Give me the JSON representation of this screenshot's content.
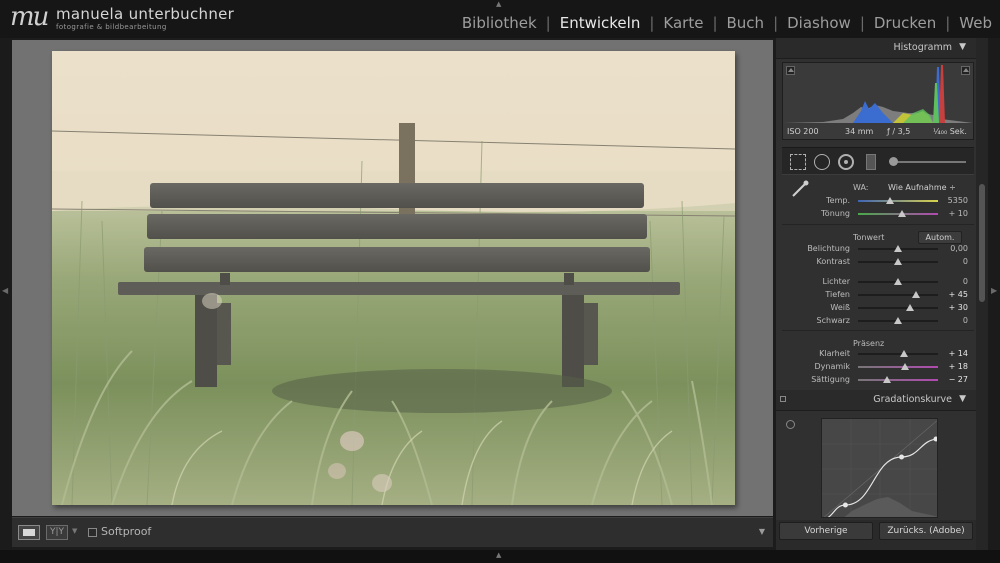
{
  "brand": {
    "mark": "mu",
    "name": "manuela unterbuchner",
    "tagline": "fotografie & bildbearbeitung"
  },
  "modules": [
    {
      "label": "Bibliothek",
      "active": false
    },
    {
      "label": "Entwickeln",
      "active": true
    },
    {
      "label": "Karte",
      "active": false
    },
    {
      "label": "Buch",
      "active": false
    },
    {
      "label": "Diashow",
      "active": false
    },
    {
      "label": "Drucken",
      "active": false
    },
    {
      "label": "Web",
      "active": false
    }
  ],
  "module_separator": "|",
  "toolbar": {
    "view_mode": "loupe-icon",
    "before_after_label": "Y|Y",
    "softproof_label": "Softproof",
    "softproof_checked": false
  },
  "histogram": {
    "title": "Histogramm",
    "iso": "ISO 200",
    "focal": "34 mm",
    "aperture": "ƒ / 3,5",
    "shutter": "¹⁄₄₀₀ Sek."
  },
  "basic": {
    "wa_label": "WA:",
    "wa_value": "Wie Aufnahme ÷",
    "auto_label": "Autom.",
    "tonwert_label": "Tonwert",
    "praesenz_label": "Präsenz",
    "sliders": [
      {
        "label": "Temp.",
        "value": "5350",
        "level": 0.4,
        "gradient": "temp"
      },
      {
        "label": "Tönung",
        "value": "+ 10",
        "level": 0.55,
        "gradient": "tint"
      },
      {
        "label": "Belichtung",
        "value": "0,00",
        "level": 0.5
      },
      {
        "label": "Kontrast",
        "value": "0",
        "level": 0.5
      },
      {
        "label": "Lichter",
        "value": "0",
        "level": 0.5
      },
      {
        "label": "Tiefen",
        "value": "+ 45",
        "level": 0.725,
        "bright": true
      },
      {
        "label": "Weiß",
        "value": "+ 30",
        "level": 0.65,
        "bright": true
      },
      {
        "label": "Schwarz",
        "value": "0",
        "level": 0.5
      },
      {
        "label": "Klarheit",
        "value": "+ 14",
        "level": 0.57,
        "bright": true
      },
      {
        "label": "Dynamik",
        "value": "+ 18",
        "level": 0.59,
        "bright": true,
        "gradient": "dyn"
      },
      {
        "label": "Sättigung",
        "value": "− 27",
        "level": 0.365,
        "bright": true,
        "gradient": "sat"
      }
    ]
  },
  "curve": {
    "title": "Gradationskurve",
    "points": [
      [
        0.0,
        0.0
      ],
      [
        0.2,
        0.14
      ],
      [
        0.68,
        0.62
      ],
      [
        1.0,
        0.8
      ]
    ]
  },
  "buttons": {
    "previous": "Vorherige",
    "reset": "Zurücks. (Adobe)"
  },
  "colors": {
    "accent_text": "#e8e8e8",
    "panel": "#303030",
    "preview_bg": "#727272"
  }
}
